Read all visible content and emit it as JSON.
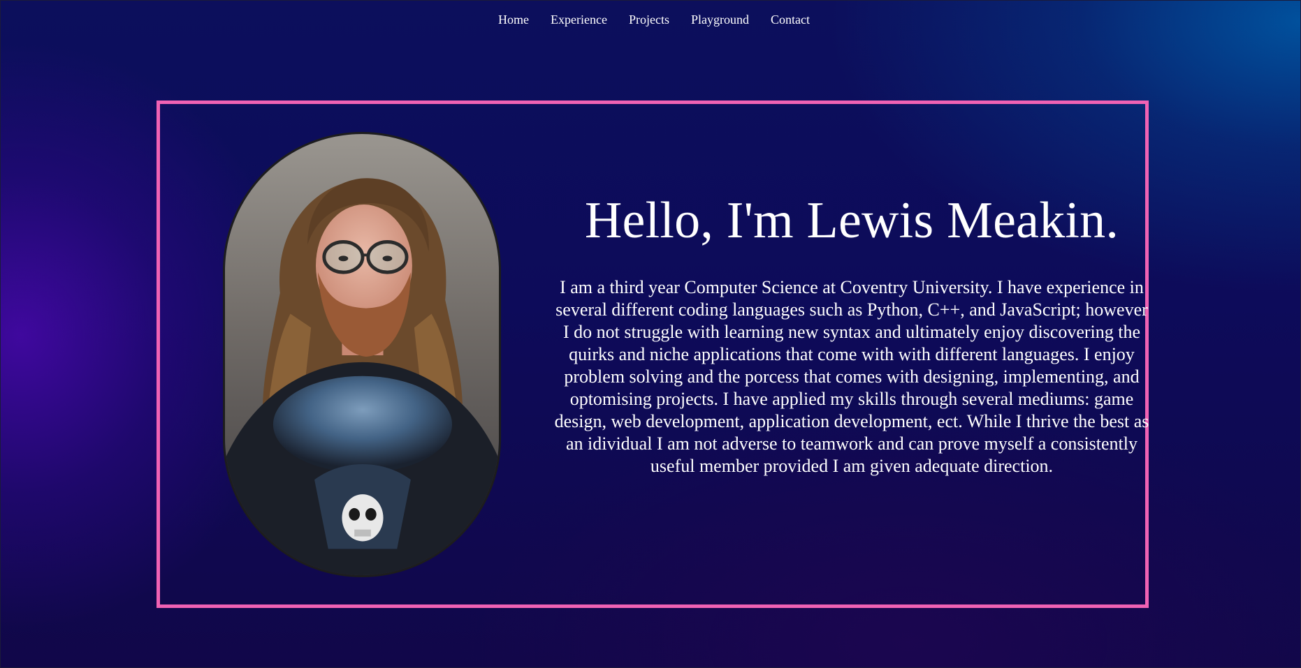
{
  "nav": {
    "items": [
      {
        "label": "Home"
      },
      {
        "label": "Experience"
      },
      {
        "label": "Projects"
      },
      {
        "label": "Playground"
      },
      {
        "label": "Contact"
      }
    ]
  },
  "hero": {
    "title": "Hello, I'm Lewis Meakin.",
    "bio": "I am a third year Computer Science at Coventry University. I have experience in several different coding languages such as Python, C++, and JavaScript; however I do not struggle with learning new syntax and ultimately enjoy discovering the quirks and niche applications that come with with different languages. I enjoy problem solving and the porcess that comes with designing, implementing, and optomising projects. I have applied my skills through several mediums: game design, web development, application development, ect. While I thrive the best as an idividual I am not adverse to teamwork and can prove myself a consistently useful member provided I am given adequate direction.",
    "portrait_icon": "portrait-photo"
  },
  "colors": {
    "frame_border": "#f062b4",
    "text": "#ffffff",
    "background_dark": "#0c0f5c",
    "glow_left": "#4808aa",
    "glow_top_right": "#0054a0"
  }
}
